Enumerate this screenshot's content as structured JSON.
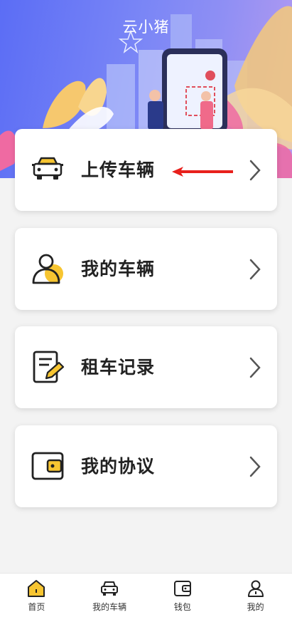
{
  "header": {
    "title": "云小猪"
  },
  "menu": [
    {
      "label": "上传车辆"
    },
    {
      "label": "我的车辆"
    },
    {
      "label": "租车记录"
    },
    {
      "label": "我的协议"
    }
  ],
  "tabs": [
    {
      "label": "首页",
      "icon": "home-icon"
    },
    {
      "label": "我的车辆",
      "icon": "car-icon"
    },
    {
      "label": "钱包",
      "icon": "wallet-icon"
    },
    {
      "label": "我的",
      "icon": "user-icon"
    }
  ],
  "colors": {
    "accent": "#f7c531",
    "header": "#5b6df5",
    "arrow": "#e8201c"
  }
}
